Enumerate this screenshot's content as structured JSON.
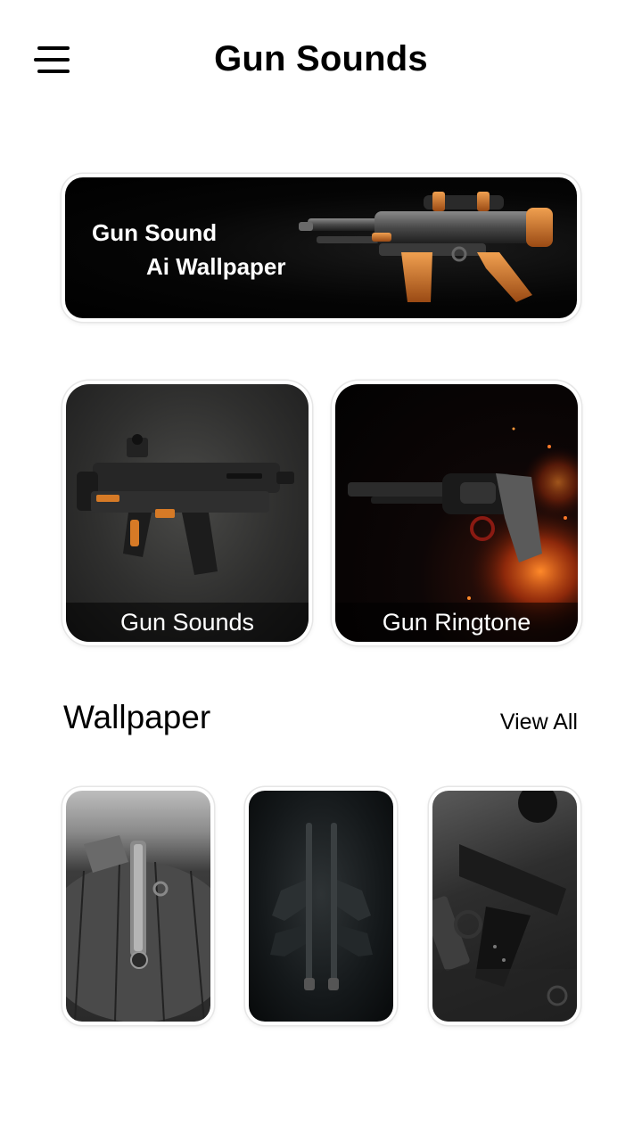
{
  "header": {
    "title": "Gun Sounds",
    "menu_icon": "hamburger-menu-icon"
  },
  "banner": {
    "line1": "Gun Sound",
    "line2": "Ai Wallpaper",
    "image": "orange-black-blaster-rifle"
  },
  "features": [
    {
      "label": "Gun Sounds",
      "image": "tactical-smg-orange-accents"
    },
    {
      "label": "Gun Ringtone",
      "image": "revolver-with-fire-sparks"
    }
  ],
  "wallpaper": {
    "title": "Wallpaper",
    "view_all": "View All",
    "items": [
      {
        "image": "pistol-on-wooden-table"
      },
      {
        "image": "twin-pistols-dark-background"
      },
      {
        "image": "black-pistol-on-desk"
      }
    ]
  },
  "colors": {
    "background": "#ffffff",
    "text": "#000000",
    "accent_orange": "#e07a1f"
  }
}
